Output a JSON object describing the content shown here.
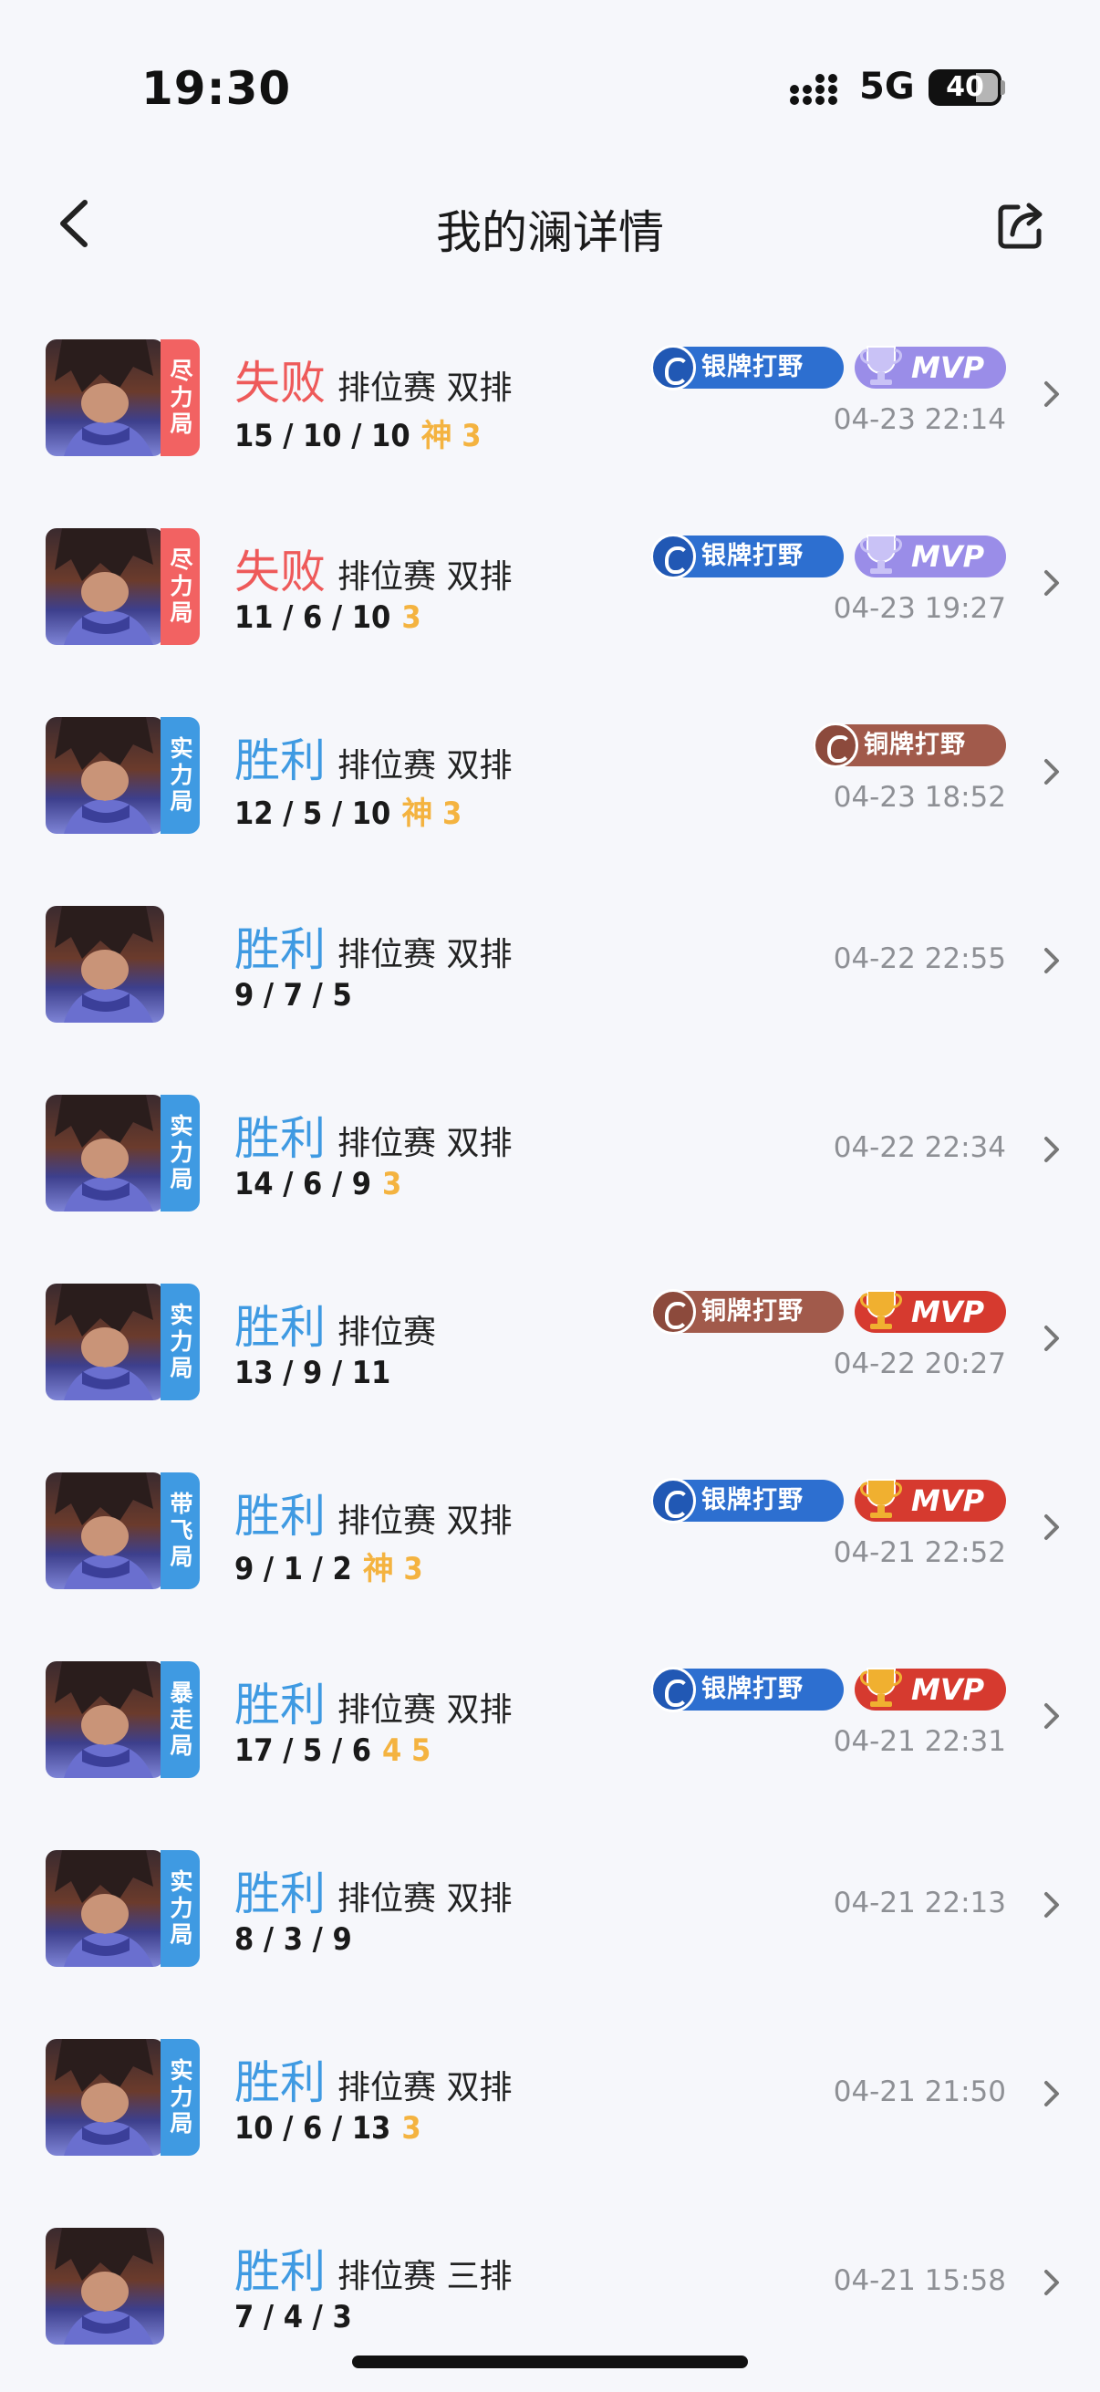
{
  "status": {
    "time": "19:30",
    "network": "5G",
    "battery": "40"
  },
  "nav": {
    "title": "我的澜详情"
  },
  "matches": [
    {
      "result": "失败",
      "result_type": "lose",
      "mode": "排位赛  双排",
      "kda": "15 / 10 / 10",
      "extra": "神 3",
      "tag": "尽力局",
      "tag_color": "red",
      "rank_badge": "银牌打野",
      "rank_tier": "silver",
      "mvp": "MVP",
      "mvp_color": "purple",
      "time": "04-23 22:14"
    },
    {
      "result": "失败",
      "result_type": "lose",
      "mode": "排位赛  双排",
      "kda": "11 / 6 / 10",
      "extra": "3",
      "tag": "尽力局",
      "tag_color": "red",
      "rank_badge": "银牌打野",
      "rank_tier": "silver",
      "mvp": "MVP",
      "mvp_color": "purple",
      "time": "04-23 19:27"
    },
    {
      "result": "胜利",
      "result_type": "win",
      "mode": "排位赛  双排",
      "kda": "12 / 5 / 10",
      "extra": "神 3",
      "tag": "实力局",
      "tag_color": "blue",
      "rank_badge": "铜牌打野",
      "rank_tier": "bronze",
      "mvp": "",
      "mvp_color": "",
      "time": "04-23 18:52"
    },
    {
      "result": "胜利",
      "result_type": "win",
      "mode": "排位赛  双排",
      "kda": "9 / 7 / 5",
      "extra": "",
      "tag": "",
      "tag_color": "",
      "rank_badge": "",
      "rank_tier": "",
      "mvp": "",
      "mvp_color": "",
      "time": "04-22 22:55"
    },
    {
      "result": "胜利",
      "result_type": "win",
      "mode": "排位赛  双排",
      "kda": "14 / 6 / 9",
      "extra": "3",
      "tag": "实力局",
      "tag_color": "blue",
      "rank_badge": "",
      "rank_tier": "",
      "mvp": "",
      "mvp_color": "",
      "time": "04-22 22:34"
    },
    {
      "result": "胜利",
      "result_type": "win",
      "mode": "排位赛",
      "kda": "13 / 9 / 11",
      "extra": "",
      "tag": "实力局",
      "tag_color": "blue",
      "rank_badge": "铜牌打野",
      "rank_tier": "bronze",
      "mvp": "MVP",
      "mvp_color": "gold",
      "time": "04-22 20:27"
    },
    {
      "result": "胜利",
      "result_type": "win",
      "mode": "排位赛  双排",
      "kda": "9 / 1 / 2",
      "extra": "神 3",
      "tag": "带飞局",
      "tag_color": "blue",
      "rank_badge": "银牌打野",
      "rank_tier": "silver",
      "mvp": "MVP",
      "mvp_color": "gold",
      "time": "04-21 22:52"
    },
    {
      "result": "胜利",
      "result_type": "win",
      "mode": "排位赛  双排",
      "kda": "17 / 5 / 6",
      "extra": "4 5",
      "tag": "暴走局",
      "tag_color": "blue",
      "rank_badge": "银牌打野",
      "rank_tier": "silver",
      "mvp": "MVP",
      "mvp_color": "gold",
      "time": "04-21 22:31"
    },
    {
      "result": "胜利",
      "result_type": "win",
      "mode": "排位赛  双排",
      "kda": "8 / 3 / 9",
      "extra": "",
      "tag": "实力局",
      "tag_color": "blue",
      "rank_badge": "",
      "rank_tier": "",
      "mvp": "",
      "mvp_color": "",
      "time": "04-21 22:13"
    },
    {
      "result": "胜利",
      "result_type": "win",
      "mode": "排位赛  双排",
      "kda": "10 / 6 / 13",
      "extra": "3",
      "tag": "实力局",
      "tag_color": "blue",
      "rank_badge": "",
      "rank_tier": "",
      "mvp": "",
      "mvp_color": "",
      "time": "04-21 21:50"
    },
    {
      "result": "胜利",
      "result_type": "win",
      "mode": "排位赛  三排",
      "kda": "7 / 4 / 3",
      "extra": "",
      "tag": "",
      "tag_color": "",
      "rank_badge": "",
      "rank_tier": "",
      "mvp": "",
      "mvp_color": "",
      "time": "04-21 15:58"
    }
  ]
}
